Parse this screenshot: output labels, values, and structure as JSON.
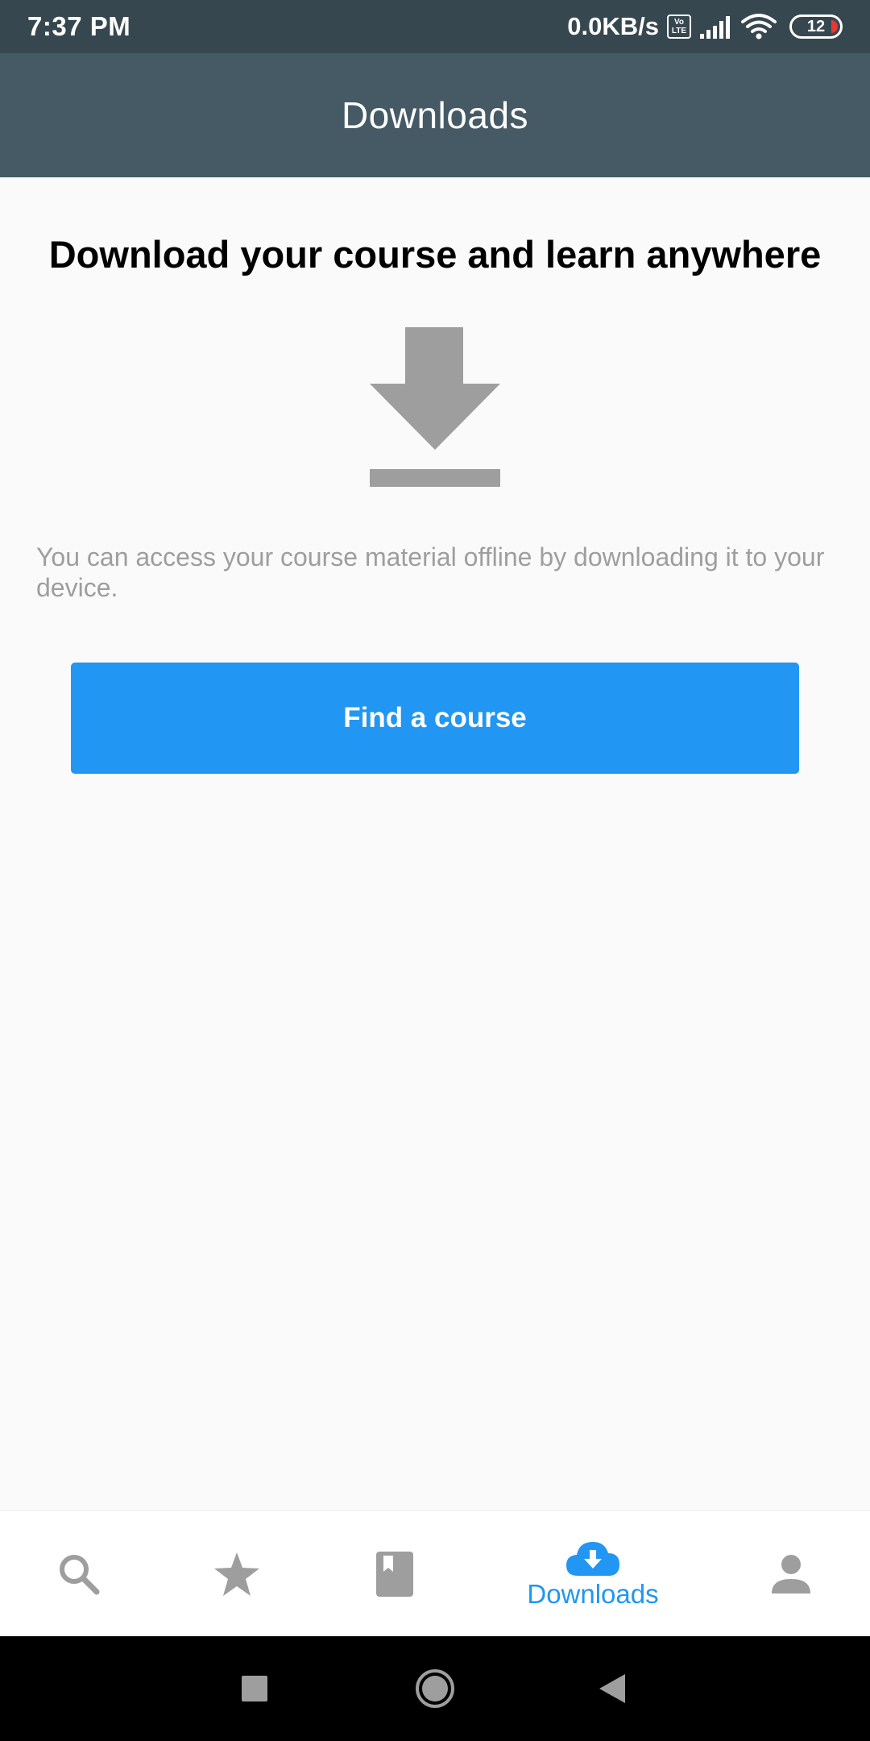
{
  "status_bar": {
    "time": "7:37 PM",
    "network_speed": "0.0KB/s",
    "volte_top": "Vo",
    "volte_bottom": "LTE",
    "battery_level": "12",
    "icons": [
      "volte-icon",
      "signal-icon",
      "wifi-icon",
      "battery-icon"
    ]
  },
  "app_bar": {
    "title": "Downloads"
  },
  "main": {
    "heading": "Download your course and learn anywhere",
    "hero_icon": "download-icon",
    "description": "You can access your course material offline by downloading it to your device.",
    "button_label": "Find a course"
  },
  "bottom_nav": {
    "items": [
      {
        "icon": "search-icon",
        "label": "",
        "active": false
      },
      {
        "icon": "star-icon",
        "label": "",
        "active": false
      },
      {
        "icon": "book-icon",
        "label": "",
        "active": false
      },
      {
        "icon": "cloud-download-icon",
        "label": "Downloads",
        "active": true
      },
      {
        "icon": "person-icon",
        "label": "",
        "active": false
      }
    ]
  },
  "system_nav": {
    "icons": [
      "recents-icon",
      "home-icon",
      "back-icon"
    ]
  },
  "colors": {
    "status_bar": "#37474f",
    "app_bar": "#455a64",
    "accent": "#2196f3",
    "icon_gray": "#9e9e9e",
    "text_secondary": "#9e9e9e",
    "background": "#fafafa"
  }
}
